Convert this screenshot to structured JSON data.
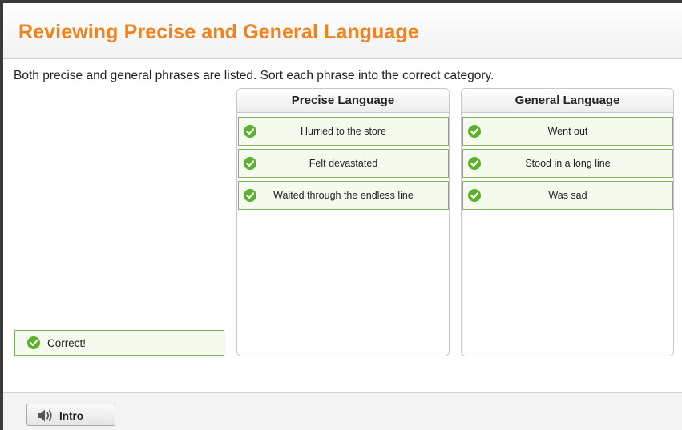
{
  "header": {
    "title": "Reviewing Precise and General Language"
  },
  "instructions": "Both precise and general phrases are listed. Sort each phrase into the correct category.",
  "bins": [
    {
      "heading": "Precise Language",
      "items": [
        "Hurried to the store",
        "Felt devastated",
        "Waited through the endless line"
      ]
    },
    {
      "heading": "General Language",
      "items": [
        "Went out",
        "Stood in a long line",
        "Was sad"
      ]
    }
  ],
  "feedback": {
    "text": "Correct!"
  },
  "footer": {
    "intro_label": "Intro"
  },
  "colors": {
    "title": "#f0821e",
    "check": "#5cb02b",
    "tile_border": "#7fb35e",
    "tile_bg": "#f4fbee"
  },
  "icons": {
    "check": "check-circle-icon",
    "speaker": "speaker-icon"
  }
}
